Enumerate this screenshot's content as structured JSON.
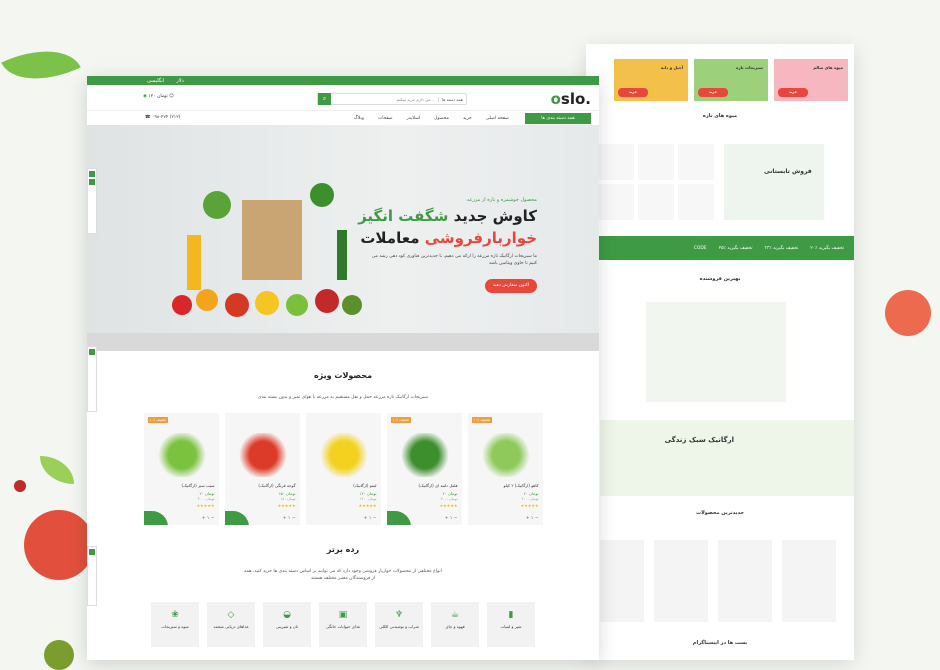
{
  "front": {
    "topbar": {
      "language": "انگلیسی",
      "currency": "دلار"
    },
    "header": {
      "logo_main": "slo.",
      "logo_o": "o",
      "search_placeholder": "من دارم خرید میکنم...",
      "search_category": "همه دسته ها",
      "cart_total": "۱۲۰ تومان"
    },
    "nav": {
      "categories_button": "همه دسته بندی ها",
      "links": [
        "صفحه اصلی",
        "خرید",
        "محصول",
        "اسلایدر",
        "صفحات",
        "وبلاگ"
      ],
      "phone": "۰۹۸-۲۷۴ (۲۱۲)"
    },
    "hero": {
      "eyebrow": "محصول خوشمزه و تازه از مزرعه",
      "line1_a": "کاوش جدید ",
      "line1_b": "شگفت انگیز",
      "line2_a": "خواربارفروشی",
      "line2_b": " معاملات",
      "description": "ما سبزیجات ارگانیک تازه مزرعه را ارائه می دهیم، با جدیدترین فناوری کود دهی رشد می کنیم تا حاوی ویتامین باشد",
      "cta": "اکنون سفارش دهید"
    },
    "featured": {
      "title": "محصولات ویژه",
      "subtitle": "سبزیجات ارگانیک تازه مزرعه حمل و نقل مستقیم به مزرعه با هوای تمیز و بدون بسته بندی",
      "products": [
        {
          "name": "کاهو (ارگانیک) ۲ کیلو",
          "price": "۲۰ تومان",
          "old": "۳۰۰۰ تومان",
          "badge": "۱۰٪ تخفیف"
        },
        {
          "name": "فلفل دلمه ای (ارگانیک)",
          "price": "۲۰ تومان",
          "old": "۳۰۰۰ تومان",
          "badge": "۱۰٪ تخفیف"
        },
        {
          "name": "لیمو (ارگانیک)",
          "price": "۱۲۰ تومان",
          "old": "۱۴۰۰ تومان",
          "badge": ""
        },
        {
          "name": "گوجه فرنگی (ارگانیک)",
          "price": "۱۵۰ تومان",
          "old": "۱۸۰ تومان",
          "badge": ""
        },
        {
          "name": "سیب سبز (ارگانیک)",
          "price": "۲۰ تومان",
          "old": "۳۰۰۰ تومان",
          "badge": "۱۰٪ تخفیف"
        }
      ]
    },
    "top_categories": {
      "title": "رده برتر",
      "subtitle": "انواع مختلفی از محصولات خواربار فروشی وجود دارد که می توانید بر اساس دسته بندی ها خرید کنید، همه از فروشندگان معتبر مختلف هستند",
      "items": [
        "شیر و لبنیات",
        "قهوه و چای",
        "شراب و نوشیدنی الکلی",
        "غذای حیوانات خانگی",
        "نان و شیرینی",
        "غذاهای دریایی منجمد",
        "میوه و سبزیجات"
      ]
    }
  },
  "back": {
    "banners": [
      "میوه های سالم",
      "سبزیجات تازه",
      "آجیل و دانه"
    ],
    "fresh_title": "میوه های تازه",
    "promo": "فروش تابستانی",
    "stripe": [
      "۲۰٪ تخفیف بگیرید",
      "۳۳٪ تخفیف بگیرید",
      "۲۵٪ تخفیف بگیرید",
      "CODE"
    ],
    "best_sellers": "بهترین فروشنده",
    "organic": "ارگانیک سبک زندگی",
    "newest": "جدیدترین محصولات",
    "instagram": "پست ها در اینستاگرام"
  },
  "colors": {
    "brand": "#3f9a45",
    "accent": "#e8473b"
  }
}
